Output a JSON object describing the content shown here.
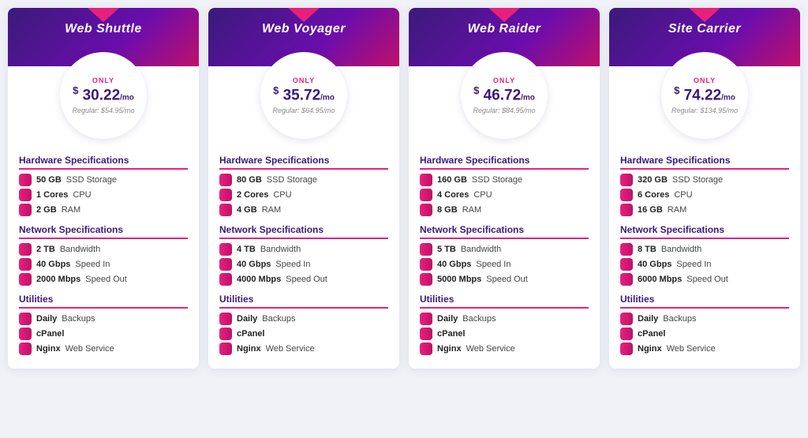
{
  "plans": [
    {
      "id": "web-shuttle",
      "name": "Web Shuttle",
      "only_label": "ONLY",
      "price": "30.22",
      "per_mo": "/mo",
      "regular": "Regular: $54.95/mo",
      "hardware_title": "Hardware Specifications",
      "hardware": [
        {
          "bold": "50 GB",
          "label": " SSD Storage",
          "icon": "storage"
        },
        {
          "bold": "1 Cores",
          "label": " CPU",
          "icon": "cpu"
        },
        {
          "bold": "2 GB",
          "label": " RAM",
          "icon": "ram"
        }
      ],
      "network_title": "Network Specifications",
      "network": [
        {
          "bold": "2 TB",
          "label": " Bandwidth",
          "icon": "bandwidth"
        },
        {
          "bold": "40 Gbps",
          "label": " Speed In",
          "icon": "speed-in"
        },
        {
          "bold": "2000 Mbps",
          "label": " Speed Out",
          "icon": "speed-out"
        }
      ],
      "utilities_title": "Utilities",
      "utilities": [
        {
          "bold": "Daily",
          "label": " Backups",
          "icon": "backup"
        },
        {
          "bold": "cPanel",
          "label": "",
          "icon": "cpanel"
        },
        {
          "bold": "Nginx",
          "label": " Web Service",
          "icon": "nginx"
        }
      ]
    },
    {
      "id": "web-voyager",
      "name": "Web Voyager",
      "only_label": "ONLY",
      "price": "35.72",
      "per_mo": "/mo",
      "regular": "Regular: $64.95/mo",
      "hardware_title": "Hardware Specifications",
      "hardware": [
        {
          "bold": "80 GB",
          "label": " SSD Storage",
          "icon": "storage"
        },
        {
          "bold": "2 Cores",
          "label": " CPU",
          "icon": "cpu"
        },
        {
          "bold": "4 GB",
          "label": " RAM",
          "icon": "ram"
        }
      ],
      "network_title": "Network Specifications",
      "network": [
        {
          "bold": "4 TB",
          "label": " Bandwidth",
          "icon": "bandwidth"
        },
        {
          "bold": "40 Gbps",
          "label": " Speed In",
          "icon": "speed-in"
        },
        {
          "bold": "4000 Mbps",
          "label": " Speed Out",
          "icon": "speed-out"
        }
      ],
      "utilities_title": "Utilities",
      "utilities": [
        {
          "bold": "Daily",
          "label": " Backups",
          "icon": "backup"
        },
        {
          "bold": "cPanel",
          "label": "",
          "icon": "cpanel"
        },
        {
          "bold": "Nginx",
          "label": " Web Service",
          "icon": "nginx"
        }
      ]
    },
    {
      "id": "web-raider",
      "name": "Web Raider",
      "only_label": "ONLY",
      "price": "46.72",
      "per_mo": "/mo",
      "regular": "Regular: $84.95/mo",
      "hardware_title": "Hardware Specifications",
      "hardware": [
        {
          "bold": "160 GB",
          "label": " SSD Storage",
          "icon": "storage"
        },
        {
          "bold": "4 Cores",
          "label": " CPU",
          "icon": "cpu"
        },
        {
          "bold": "8 GB",
          "label": " RAM",
          "icon": "ram"
        }
      ],
      "network_title": "Network Specifications",
      "network": [
        {
          "bold": "5 TB",
          "label": " Bandwidth",
          "icon": "bandwidth"
        },
        {
          "bold": "40 Gbps",
          "label": " Speed In",
          "icon": "speed-in"
        },
        {
          "bold": "5000 Mbps",
          "label": " Speed Out",
          "icon": "speed-out"
        }
      ],
      "utilities_title": "Utilities",
      "utilities": [
        {
          "bold": "Daily",
          "label": " Backups",
          "icon": "backup"
        },
        {
          "bold": "cPanel",
          "label": "",
          "icon": "cpanel"
        },
        {
          "bold": "Nginx",
          "label": " Web Service",
          "icon": "nginx"
        }
      ]
    },
    {
      "id": "site-carrier",
      "name": "Site Carrier",
      "only_label": "ONLY",
      "price": "74.22",
      "per_mo": "/mo",
      "regular": "Regular: $134.95/mo",
      "hardware_title": "Hardware Specifications",
      "hardware": [
        {
          "bold": "320 GB",
          "label": " SSD Storage",
          "icon": "storage"
        },
        {
          "bold": "6 Cores",
          "label": " CPU",
          "icon": "cpu"
        },
        {
          "bold": "16 GB",
          "label": " RAM",
          "icon": "ram"
        }
      ],
      "network_title": "Network Specifications",
      "network": [
        {
          "bold": "8 TB",
          "label": " Bandwidth",
          "icon": "bandwidth"
        },
        {
          "bold": "40 Gbps",
          "label": " Speed In",
          "icon": "speed-in"
        },
        {
          "bold": "6000 Mbps",
          "label": " Speed Out",
          "icon": "speed-out"
        }
      ],
      "utilities_title": "Utilities",
      "utilities": [
        {
          "bold": "Daily",
          "label": " Backups",
          "icon": "backup"
        },
        {
          "bold": "cPanel",
          "label": "",
          "icon": "cpanel"
        },
        {
          "bold": "Nginx",
          "label": " Web Service",
          "icon": "nginx"
        }
      ]
    }
  ]
}
